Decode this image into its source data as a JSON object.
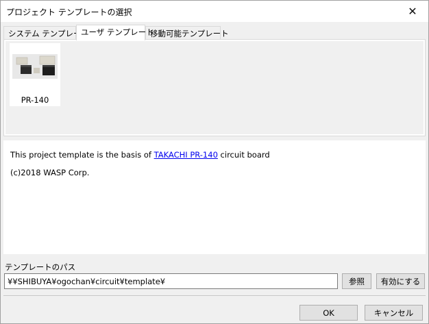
{
  "window": {
    "title": "プロジェクト テンプレートの選択",
    "close_icon": "close-icon"
  },
  "tabs": [
    {
      "label": "システム テンプレート",
      "active": false
    },
    {
      "label": "ユーザ テンプレート",
      "active": true
    },
    {
      "label": "移動可能テンプレート",
      "active": false
    }
  ],
  "templates": [
    {
      "label": "PR-140",
      "thumbnail": "enclosure-boxes-image"
    }
  ],
  "description": {
    "prefix": "This project template is the basis of ",
    "link_text": "TAKACHI PR-140",
    "suffix": " circuit board",
    "copyright": "(c)2018 WASP Corp."
  },
  "path": {
    "label": "テンプレートのパス",
    "value": "¥¥SHIBUYA¥ogochan¥circuit¥template¥"
  },
  "buttons": {
    "browse": "参照",
    "enable": "有効にする",
    "ok": "OK",
    "cancel": "キャンセル"
  },
  "colors": {
    "link": "#0000ee",
    "panel_bg": "#f0f0f0"
  }
}
